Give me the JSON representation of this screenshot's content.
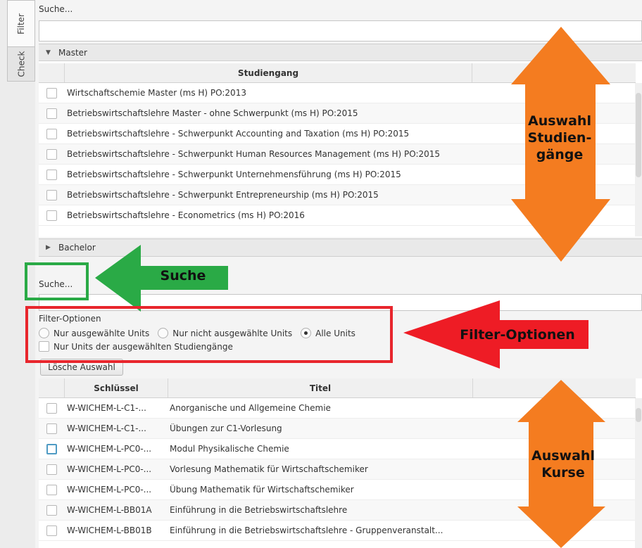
{
  "side_tabs": {
    "filter": "Filter",
    "check": "Check"
  },
  "top_search": {
    "placeholder": "Suche...",
    "value": ""
  },
  "master": {
    "section_label": "Master",
    "column_header": "Studiengang",
    "rows": [
      {
        "label": "Wirtschaftschemie Master (ms H) PO:2013",
        "checked": false
      },
      {
        "label": "Betriebswirtschaftslehre Master - ohne Schwerpunkt (ms H) PO:2015",
        "checked": false
      },
      {
        "label": "Betriebswirtschaftslehre - Schwerpunkt Accounting and Taxation (ms H) PO:2015",
        "checked": false
      },
      {
        "label": "Betriebswirtschaftslehre - Schwerpunkt Human Resources Management (ms H) PO:2015",
        "checked": false
      },
      {
        "label": "Betriebswirtschaftslehre - Schwerpunkt Unternehmensführung (ms H) PO:2015",
        "checked": false
      },
      {
        "label": "Betriebswirtschaftslehre - Schwerpunkt Entrepreneurship (ms H) PO:2015",
        "checked": false
      },
      {
        "label": "Betriebswirtschaftslehre - Econometrics (ms H) PO:2016",
        "checked": false
      }
    ]
  },
  "bachelor": {
    "section_label": "Bachelor"
  },
  "unit_search": {
    "placeholder": "Suche...",
    "value": ""
  },
  "filter": {
    "title": "Filter-Optionen",
    "radio_selected": "Nur ausgewählte Units",
    "radio_not_selected": "Nur nicht ausgewählte Units",
    "radio_all": "Alle Units",
    "checkbox_label": "Nur Units der ausgewählten Studiengänge",
    "selected_option": "Alle Units"
  },
  "clear_button": "Lösche Auswahl",
  "courses": {
    "col_key": "Schlüssel",
    "col_title": "Titel",
    "rows": [
      {
        "key": "W-WICHEM-L-C1-...",
        "title": "Anorganische und Allgemeine Chemie"
      },
      {
        "key": "W-WICHEM-L-C1-...",
        "title": "Übungen zur C1-Vorlesung"
      },
      {
        "key": "W-WICHEM-L-PC0-...",
        "title": "Modul Physikalische Chemie"
      },
      {
        "key": "W-WICHEM-L-PC0-...",
        "title": "Vorlesung Mathematik für Wirtschaftschemiker"
      },
      {
        "key": "W-WICHEM-L-PC0-...",
        "title": "Übung Mathematik für Wirtschaftschemiker"
      },
      {
        "key": "W-WICHEM-L-BB01A",
        "title": "Einführung in die Betriebswirtschaftslehre"
      },
      {
        "key": "W-WICHEM-L-BB01B",
        "title": "Einführung in die Betriebswirtschaftslehre - Gruppenveranstalt..."
      }
    ]
  },
  "annotations": {
    "studiengaenge_line1": "Auswahl",
    "studiengaenge_line2": "Studien-",
    "studiengaenge_line3": "gänge",
    "suche": "Suche",
    "filter_optionen": "Filter-Optionen",
    "kurse_line1": "Auswahl",
    "kurse_line2": "Kurse"
  },
  "colors": {
    "orange": "#f47c20",
    "green": "#2aaa46",
    "red": "#ee1c25",
    "focus": "#4f9bc4"
  }
}
